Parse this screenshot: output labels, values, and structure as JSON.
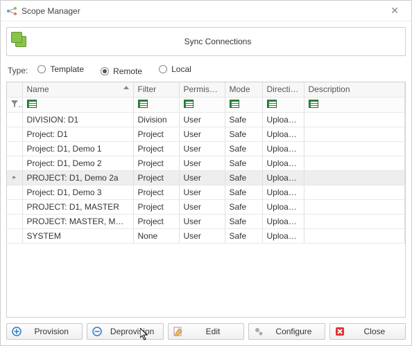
{
  "window": {
    "title": "Scope Manager"
  },
  "header": {
    "title": "Sync Connections"
  },
  "type": {
    "label": "Type:",
    "options": [
      {
        "label": "Template",
        "checked": false
      },
      {
        "label": "Remote",
        "checked": true
      },
      {
        "label": "Local",
        "checked": false
      }
    ]
  },
  "columns": {
    "name": "Name",
    "filter": "Filter",
    "permission": "Permission",
    "mode": "Mode",
    "direction": "Direction",
    "description": "Description"
  },
  "rows": [
    {
      "name": "DIVISION: D1",
      "filter": "Division",
      "permission": "User",
      "mode": "Safe",
      "direction": "UploadA...",
      "description": "",
      "selected": false,
      "expand": false
    },
    {
      "name": "Project: D1",
      "filter": "Project",
      "permission": "User",
      "mode": "Safe",
      "direction": "UploadA...",
      "description": "",
      "selected": false,
      "expand": false
    },
    {
      "name": "Project: D1, Demo 1",
      "filter": "Project",
      "permission": "User",
      "mode": "Safe",
      "direction": "UploadA...",
      "description": "",
      "selected": false,
      "expand": false
    },
    {
      "name": "Project: D1, Demo 2",
      "filter": "Project",
      "permission": "User",
      "mode": "Safe",
      "direction": "UploadA...",
      "description": "",
      "selected": false,
      "expand": false
    },
    {
      "name": "PROJECT: D1, Demo 2a",
      "filter": "Project",
      "permission": "User",
      "mode": "Safe",
      "direction": "UploadA...",
      "description": "",
      "selected": true,
      "expand": true
    },
    {
      "name": "Project: D1, Demo 3",
      "filter": "Project",
      "permission": "User",
      "mode": "Safe",
      "direction": "UploadA...",
      "description": "",
      "selected": false,
      "expand": false
    },
    {
      "name": "PROJECT: D1, MASTER",
      "filter": "Project",
      "permission": "User",
      "mode": "Safe",
      "direction": "UploadA...",
      "description": "",
      "selected": false,
      "expand": false
    },
    {
      "name": "PROJECT: MASTER, MASTER",
      "filter": "Project",
      "permission": "User",
      "mode": "Safe",
      "direction": "UploadA...",
      "description": "",
      "selected": false,
      "expand": false
    },
    {
      "name": "SYSTEM",
      "filter": "None",
      "permission": "User",
      "mode": "Safe",
      "direction": "UploadA...",
      "description": "",
      "selected": false,
      "expand": false
    }
  ],
  "buttons": {
    "provision": "Provision",
    "deprovision": "Deprovision",
    "edit": "Edit",
    "configure": "Configure",
    "close": "Close"
  }
}
